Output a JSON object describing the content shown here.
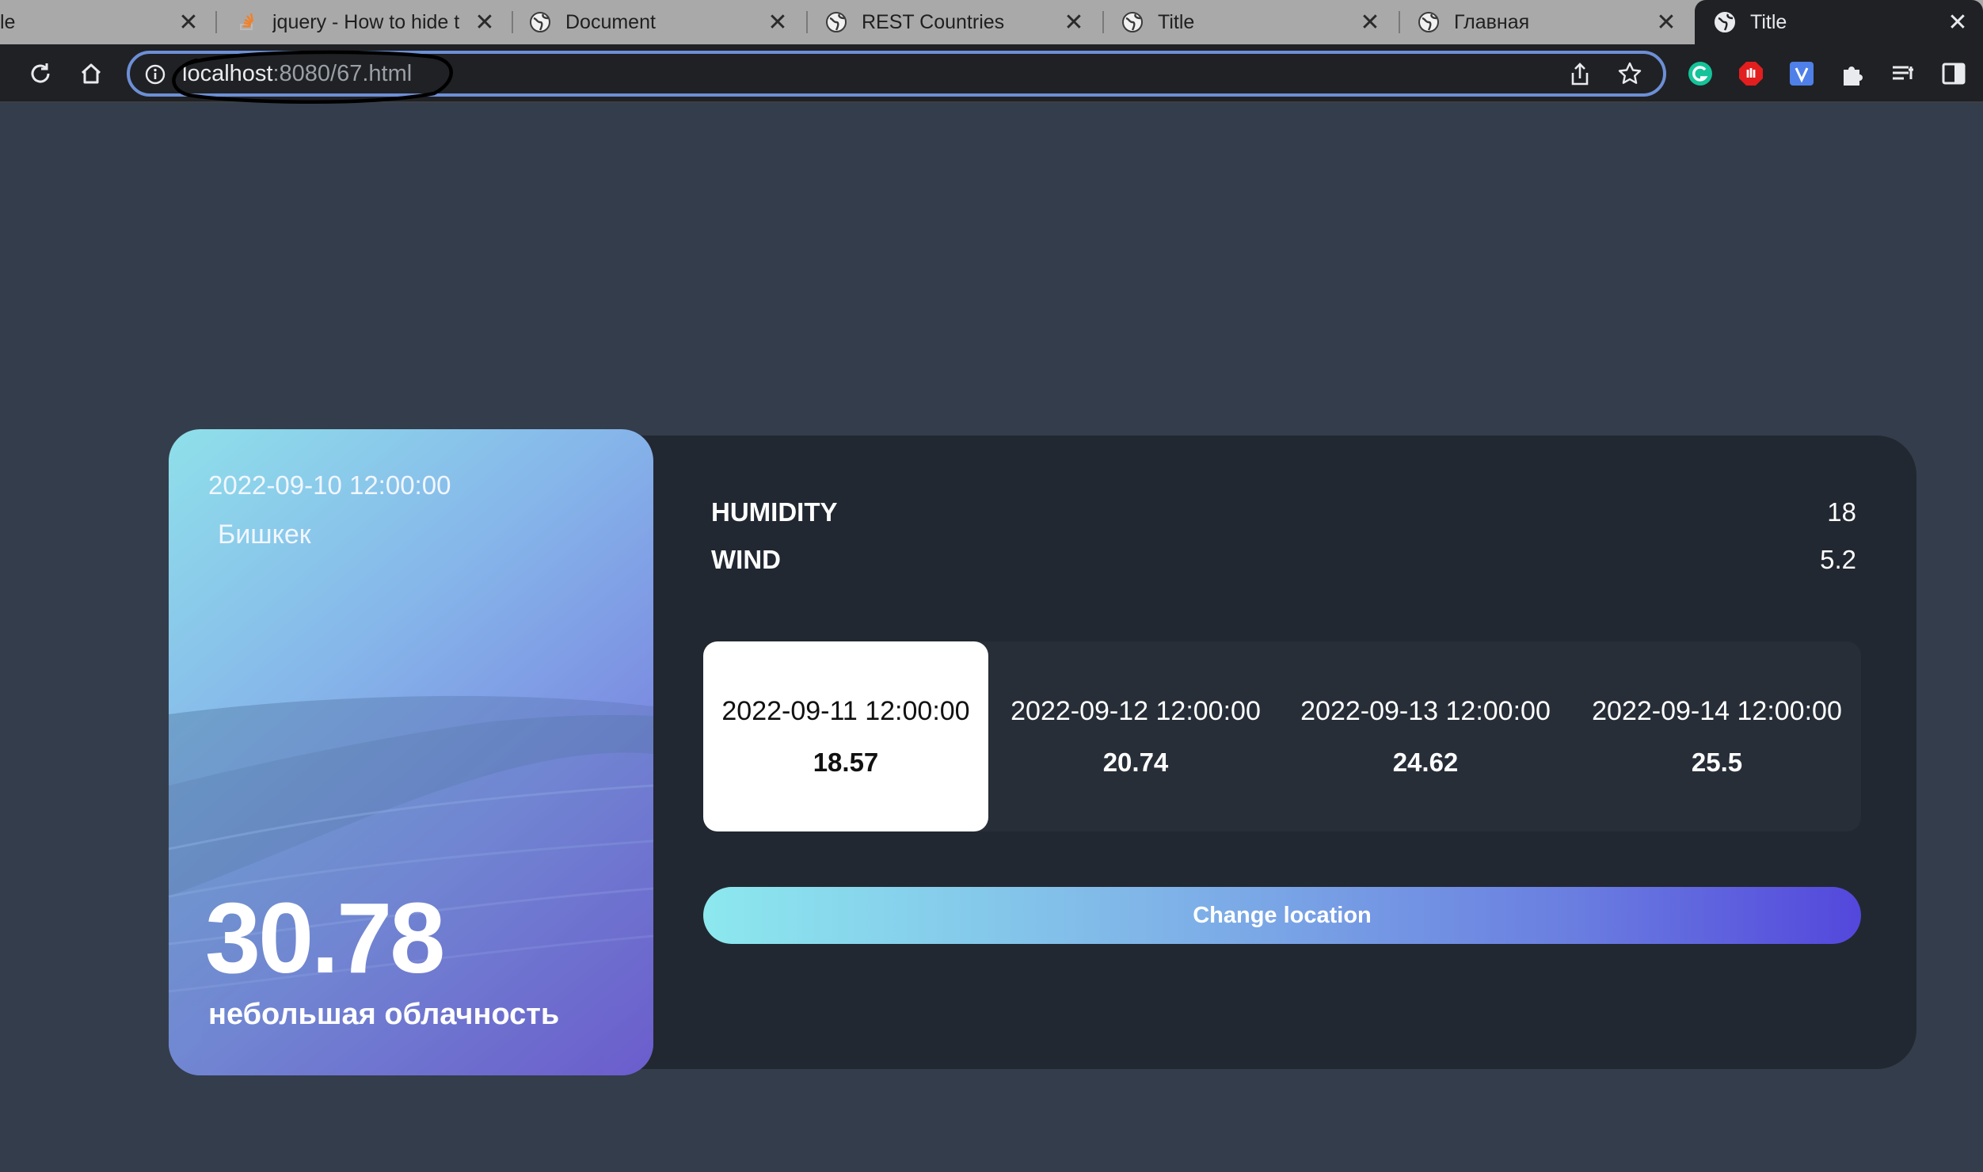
{
  "browser": {
    "tabs": [
      {
        "title": "le",
        "favicon": "none"
      },
      {
        "title": "jquery - How to hide t",
        "favicon": "stackoverflow-icon"
      },
      {
        "title": "Document",
        "favicon": "globe-icon"
      },
      {
        "title": "REST Countries",
        "favicon": "globe-icon"
      },
      {
        "title": "Title",
        "favicon": "globe-icon"
      },
      {
        "title": "Главная",
        "favicon": "globe-icon"
      },
      {
        "title": "Title",
        "favicon": "globe-icon"
      }
    ],
    "url_host": "localhost",
    "url_path": ":8080/67.html"
  },
  "weather": {
    "date": "2022-09-10 12:00:00",
    "city": "Бишкек",
    "temp": "30.78",
    "description": "небольшая облачность"
  },
  "stats": {
    "humidity_label": "HUMIDITY",
    "humidity_value": "18",
    "wind_label": "WIND",
    "wind_value": "5.2"
  },
  "forecast": [
    {
      "date": "2022-09-11 12:00:00",
      "temp": "18.57",
      "active": true
    },
    {
      "date": "2022-09-12 12:00:00",
      "temp": "20.74",
      "active": false
    },
    {
      "date": "2022-09-13 12:00:00",
      "temp": "24.62",
      "active": false
    },
    {
      "date": "2022-09-14 12:00:00",
      "temp": "25.5",
      "active": false
    }
  ],
  "change_location_label": "Change location"
}
